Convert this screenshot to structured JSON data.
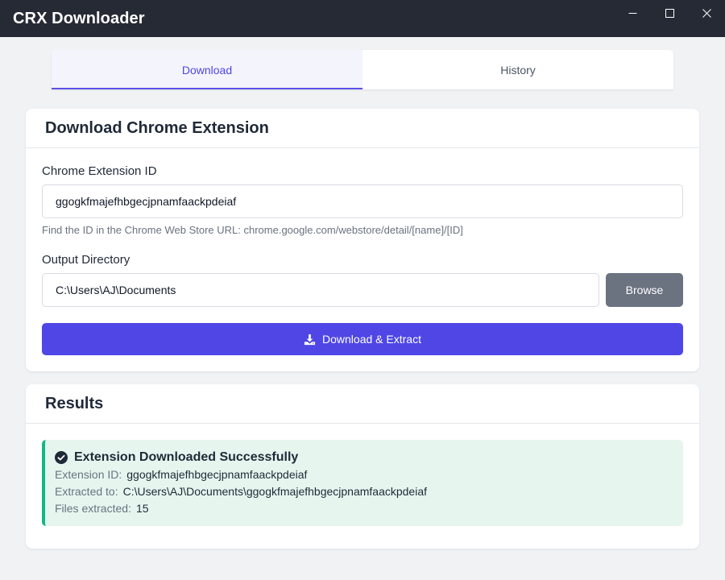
{
  "app": {
    "title": "CRX Downloader"
  },
  "window_controls": {
    "minimize": "minimize-icon",
    "maximize": "maximize-icon",
    "close": "close-icon"
  },
  "tabs": [
    {
      "label": "Download",
      "active": true
    },
    {
      "label": "History",
      "active": false
    }
  ],
  "download_card": {
    "title": "Download Chrome Extension",
    "extension_id_label": "Chrome Extension ID",
    "extension_id_value": "ggogkfmajefhbgecjpnamfaackpdeiaf",
    "extension_id_help": "Find the ID in the Chrome Web Store URL: chrome.google.com/webstore/detail/[name]/[ID]",
    "output_dir_label": "Output Directory",
    "output_dir_value": "C:\\Users\\AJ\\Documents",
    "browse_label": "Browse",
    "download_label": "Download & Extract",
    "download_icon": "download-icon"
  },
  "results_card": {
    "title": "Results",
    "result": {
      "status_icon": "check-circle-icon",
      "title": "Extension Downloaded Successfully",
      "extension_id_key": "Extension ID:",
      "extension_id_val": "ggogkfmajefhbgecjpnamfaackpdeiaf",
      "extracted_to_key": "Extracted to:",
      "extracted_to_val": "C:\\Users\\AJ\\Documents\\ggogkfmajefhbgecjpnamfaackpdeiaf",
      "files_key": "Files extracted:",
      "files_val": "15"
    }
  },
  "colors": {
    "titlebar": "#262a34",
    "accent": "#4f46e5",
    "success_bg": "#e6f6ef",
    "success_border": "#10b981",
    "secondary_button": "#6b7280"
  }
}
